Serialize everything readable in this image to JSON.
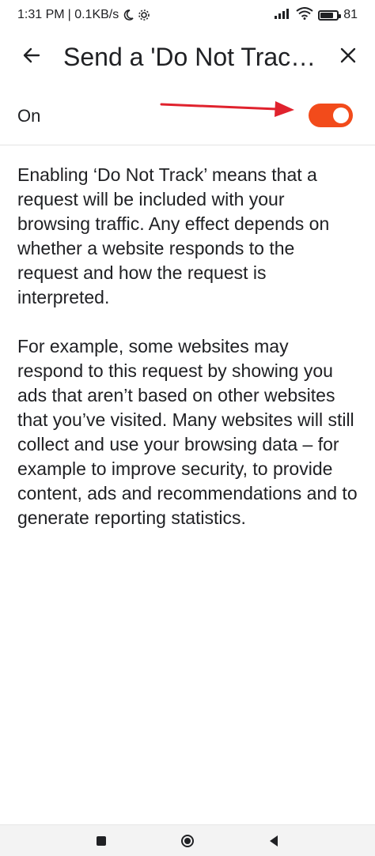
{
  "status_bar": {
    "time": "1:31 PM",
    "network_speed": "| 0.1KB/s",
    "battery_percent": "81"
  },
  "toolbar": {
    "title": "Send a 'Do Not Track' request",
    "back_icon": "arrow-back-icon",
    "close_icon": "close-icon"
  },
  "setting": {
    "label": "On",
    "enabled": true,
    "accent_color": "#f24b1b"
  },
  "content": {
    "paragraph1": "Enabling ‘Do Not Track’ means that a request will be included with your browsing traffic. Any effect depends on whether a website responds to the request and how the request is interpreted.",
    "paragraph2": "For example, some websites may respond to this request by showing you ads that aren’t based on other websites that you’ve visited. Many websites will still collect and use your browsing data – for example to improve security, to provide content, ads and recommendations and to generate reporting statistics."
  },
  "annotation": {
    "arrow_color": "#e0222d"
  }
}
